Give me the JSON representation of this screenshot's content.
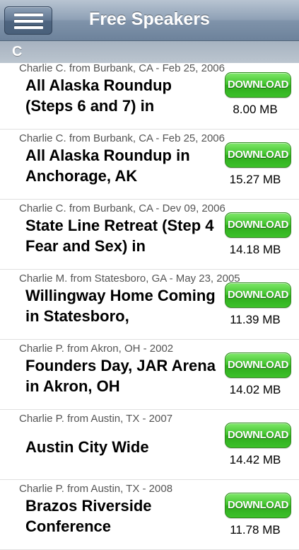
{
  "navbar": {
    "title": "Free Speakers"
  },
  "section": {
    "letter": "C"
  },
  "download_label": "DOWNLOAD",
  "items": [
    {
      "meta": "Charlie C. from Burbank, CA - Feb 25, 2006",
      "title": "All Alaska Roundup (Steps 6 and 7) in",
      "size": "8.00 MB"
    },
    {
      "meta": "Charlie C. from Burbank, CA - Feb 25, 2006",
      "title": "All Alaska Roundup in Anchorage, AK",
      "size": "15.27 MB"
    },
    {
      "meta": "Charlie C. from Burbank, CA - Dev 09, 2006",
      "title": "State Line Retreat (Step 4 Fear and Sex) in",
      "size": "14.18 MB"
    },
    {
      "meta": "Charlie M. from Statesboro, GA - May 23, 2005",
      "title": "Willingway Home Coming in Statesboro,",
      "size": "11.39 MB"
    },
    {
      "meta": "Charlie P. from Akron, OH - 2002",
      "title": "Founders Day, JAR Arena in Akron, OH",
      "size": "14.02 MB"
    },
    {
      "meta": "Charlie P. from Austin, TX - 2007",
      "title": "Austin City Wide",
      "size": "14.42 MB"
    },
    {
      "meta": "Charlie P. from Austin, TX - 2008",
      "title": "Brazos Riverside Conference",
      "size": "11.78 MB"
    }
  ]
}
